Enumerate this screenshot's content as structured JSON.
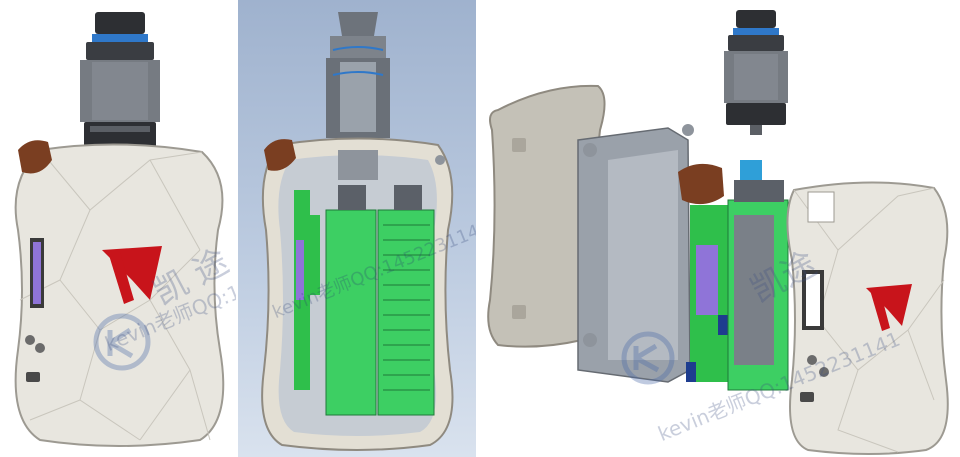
{
  "watermark": {
    "left_cn": "凯 途 ",
    "left_contact": "kevin老师QQ:1452231141",
    "right_cn": "凯途",
    "right_contact": "kevin老师QQ:1452231141"
  },
  "colors": {
    "shell": "#e8e6df",
    "shell_edge": "#b9b6ad",
    "logo_red": "#c8141b",
    "pcb_green": "#2fbf4b",
    "battery_green": "#3dcf63",
    "screen_purple": "#8f74d8",
    "wood": "#7a3e21",
    "tank_dark": "#2d2f33",
    "tank_blue": "#2f78c9",
    "frame_grey": "#9aa1aa"
  },
  "icons": [
    "brand-logo-icon",
    "watermark-logo-icon"
  ]
}
